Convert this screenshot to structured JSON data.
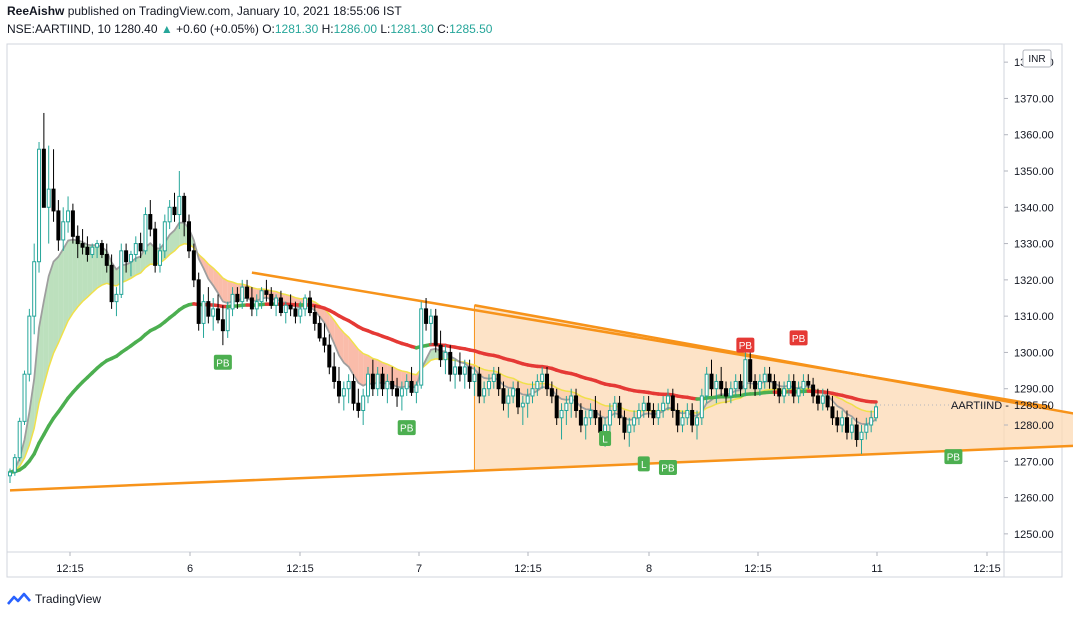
{
  "header": {
    "publisher": "ReeAishw",
    "published_text": "published on TradingView.com, January 10, 2021 18:55:06 IST",
    "symbol_tf": "NSE:AARTIIND, 10",
    "last": "1280.40",
    "change": "+0.60 (+0.05%)",
    "o_label": "O:",
    "o_value": "1281.30",
    "h_label": "H:",
    "h_value": "1286.00",
    "l_label": "L:",
    "l_value": "1281.30",
    "c_label": "C:",
    "c_value": "1285.50"
  },
  "footer": {
    "brand": "TradingView"
  },
  "colors": {
    "up": "#26a69a",
    "down": "#000000",
    "trend": "#f7931a",
    "ema_fast": "#9e9e9e",
    "ema_slow": "#4caf50",
    "ema_mid": "#f0e04a",
    "cloud_up": "#a5d6a7",
    "cloud_dn": "#f8a58e",
    "triangle_fill": "#fcd9b4",
    "red_ma": "#e53935",
    "pb_green": "#4caf50",
    "pb_red": "#e53935"
  },
  "chart_data": {
    "type": "candlestick",
    "symbol": "AARTIIND",
    "currency": "INR",
    "last_price_label": "AARTIIND",
    "last_price": 1285.5,
    "ylim": [
      1245,
      1385
    ],
    "y_ticks": [
      1250,
      1260,
      1270,
      1280,
      1290,
      1300,
      1310,
      1320,
      1330,
      1340,
      1350,
      1360,
      1370,
      1380
    ],
    "x_ticks": [
      "12:15",
      "6",
      "12:15",
      "7",
      "12:15",
      "8",
      "12:15",
      "11",
      "12:15"
    ],
    "grid": false,
    "session_labels": [
      "6",
      "7",
      "8",
      "11"
    ],
    "signals": [
      {
        "label": "PB",
        "bar": 44,
        "price": 1301,
        "side": "below",
        "color": "green"
      },
      {
        "label": "PB",
        "bar": 82,
        "price": 1283,
        "side": "below",
        "color": "green"
      },
      {
        "label": "L",
        "bar": 123,
        "price": 1280,
        "side": "below",
        "color": "green"
      },
      {
        "label": "L",
        "bar": 131,
        "price": 1273,
        "side": "below",
        "color": "green"
      },
      {
        "label": "PB",
        "bar": 136,
        "price": 1272,
        "side": "below",
        "color": "green"
      },
      {
        "label": "PB",
        "bar": 152,
        "price": 1298,
        "side": "above",
        "color": "red"
      },
      {
        "label": "PB",
        "bar": 163,
        "price": 1300,
        "side": "above",
        "color": "red"
      },
      {
        "label": "PB",
        "bar": 195,
        "price": 1275,
        "side": "below",
        "color": "green"
      }
    ],
    "trendlines": [
      {
        "from": [
          0,
          1262
        ],
        "to": [
          233,
          1275
        ]
      },
      {
        "from": [
          50,
          1322
        ],
        "to": [
          215,
          1285
        ]
      },
      {
        "from": [
          96,
          1313
        ],
        "to": [
          233,
          1280
        ]
      }
    ],
    "candles": [
      [
        1266,
        1268,
        1264,
        1267
      ],
      [
        1267,
        1272,
        1266,
        1271
      ],
      [
        1271,
        1282,
        1270,
        1281
      ],
      [
        1281,
        1295,
        1280,
        1294
      ],
      [
        1294,
        1312,
        1292,
        1310
      ],
      [
        1310,
        1330,
        1305,
        1325
      ],
      [
        1325,
        1358,
        1322,
        1356
      ],
      [
        1356,
        1366,
        1350,
        1340
      ],
      [
        1340,
        1357,
        1330,
        1345
      ],
      [
        1345,
        1356,
        1336,
        1339
      ],
      [
        1339,
        1342,
        1328,
        1331
      ],
      [
        1331,
        1340,
        1328,
        1336
      ],
      [
        1336,
        1343,
        1333,
        1339
      ],
      [
        1339,
        1341,
        1330,
        1332
      ],
      [
        1332,
        1335,
        1326,
        1330
      ],
      [
        1330,
        1334,
        1327,
        1329
      ],
      [
        1329,
        1332,
        1325,
        1327
      ],
      [
        1327,
        1330,
        1326,
        1329
      ],
      [
        1329,
        1331,
        1326,
        1330
      ],
      [
        1330,
        1331,
        1326,
        1327
      ],
      [
        1327,
        1330,
        1322,
        1324
      ],
      [
        1324,
        1327,
        1312,
        1314
      ],
      [
        1314,
        1318,
        1310,
        1316
      ],
      [
        1316,
        1330,
        1315,
        1328
      ],
      [
        1328,
        1330,
        1322,
        1325
      ],
      [
        1325,
        1328,
        1321,
        1327
      ],
      [
        1327,
        1332,
        1325,
        1330
      ],
      [
        1330,
        1333,
        1326,
        1328
      ],
      [
        1328,
        1340,
        1327,
        1338
      ],
      [
        1338,
        1342,
        1332,
        1334
      ],
      [
        1334,
        1336,
        1322,
        1324
      ],
      [
        1324,
        1330,
        1322,
        1328
      ],
      [
        1328,
        1338,
        1326,
        1336
      ],
      [
        1336,
        1342,
        1334,
        1340
      ],
      [
        1340,
        1344,
        1336,
        1338
      ],
      [
        1338,
        1350,
        1334,
        1343
      ],
      [
        1343,
        1344,
        1332,
        1336
      ],
      [
        1336,
        1338,
        1326,
        1328
      ],
      [
        1328,
        1330,
        1318,
        1320
      ],
      [
        1320,
        1322,
        1306,
        1308
      ],
      [
        1308,
        1316,
        1304,
        1314
      ],
      [
        1314,
        1318,
        1308,
        1310
      ],
      [
        1310,
        1315,
        1306,
        1312
      ],
      [
        1312,
        1316,
        1308,
        1309
      ],
      [
        1309,
        1313,
        1302,
        1306
      ],
      [
        1306,
        1314,
        1304,
        1312
      ],
      [
        1312,
        1318,
        1310,
        1316
      ],
      [
        1316,
        1318,
        1312,
        1314
      ],
      [
        1314,
        1320,
        1312,
        1318
      ],
      [
        1318,
        1320,
        1314,
        1315
      ],
      [
        1315,
        1318,
        1310,
        1312
      ],
      [
        1312,
        1316,
        1310,
        1314
      ],
      [
        1314,
        1318,
        1312,
        1317
      ],
      [
        1317,
        1320,
        1314,
        1316
      ],
      [
        1316,
        1318,
        1312,
        1313
      ],
      [
        1313,
        1316,
        1310,
        1315
      ],
      [
        1315,
        1317,
        1310,
        1311
      ],
      [
        1311,
        1314,
        1308,
        1313
      ],
      [
        1313,
        1316,
        1310,
        1312
      ],
      [
        1312,
        1314,
        1308,
        1310
      ],
      [
        1310,
        1314,
        1308,
        1312
      ],
      [
        1312,
        1316,
        1310,
        1315
      ],
      [
        1315,
        1317,
        1310,
        1311
      ],
      [
        1311,
        1313,
        1306,
        1308
      ],
      [
        1308,
        1310,
        1303,
        1304
      ],
      [
        1304,
        1308,
        1300,
        1302
      ],
      [
        1302,
        1305,
        1294,
        1296
      ],
      [
        1296,
        1300,
        1290,
        1292
      ],
      [
        1292,
        1296,
        1286,
        1288
      ],
      [
        1288,
        1292,
        1284,
        1290
      ],
      [
        1290,
        1294,
        1286,
        1292
      ],
      [
        1292,
        1294,
        1284,
        1286
      ],
      [
        1286,
        1290,
        1282,
        1284
      ],
      [
        1284,
        1290,
        1280,
        1288
      ],
      [
        1288,
        1296,
        1286,
        1294
      ],
      [
        1294,
        1298,
        1288,
        1290
      ],
      [
        1290,
        1296,
        1288,
        1294
      ],
      [
        1294,
        1296,
        1288,
        1290
      ],
      [
        1290,
        1294,
        1286,
        1292
      ],
      [
        1292,
        1296,
        1288,
        1290
      ],
      [
        1290,
        1293,
        1285,
        1288
      ],
      [
        1288,
        1292,
        1284,
        1290
      ],
      [
        1290,
        1294,
        1288,
        1292
      ],
      [
        1292,
        1296,
        1288,
        1289
      ],
      [
        1289,
        1292,
        1286,
        1291
      ],
      [
        1291,
        1314,
        1290,
        1312
      ],
      [
        1312,
        1315,
        1306,
        1308
      ],
      [
        1308,
        1312,
        1302,
        1310
      ],
      [
        1310,
        1312,
        1300,
        1302
      ],
      [
        1302,
        1306,
        1296,
        1298
      ],
      [
        1298,
        1302,
        1294,
        1300
      ],
      [
        1300,
        1302,
        1292,
        1294
      ],
      [
        1294,
        1298,
        1290,
        1296
      ],
      [
        1296,
        1300,
        1292,
        1294
      ],
      [
        1294,
        1298,
        1290,
        1296
      ],
      [
        1296,
        1298,
        1290,
        1292
      ],
      [
        1292,
        1296,
        1288,
        1294
      ],
      [
        1294,
        1296,
        1286,
        1288
      ],
      [
        1288,
        1292,
        1286,
        1290
      ],
      [
        1290,
        1294,
        1288,
        1292
      ],
      [
        1292,
        1296,
        1290,
        1294
      ],
      [
        1294,
        1296,
        1288,
        1290
      ],
      [
        1290,
        1292,
        1284,
        1286
      ],
      [
        1286,
        1290,
        1282,
        1288
      ],
      [
        1288,
        1292,
        1286,
        1290
      ],
      [
        1290,
        1292,
        1283,
        1285
      ],
      [
        1285,
        1288,
        1280,
        1286
      ],
      [
        1286,
        1290,
        1282,
        1288
      ],
      [
        1288,
        1292,
        1286,
        1290
      ],
      [
        1290,
        1294,
        1288,
        1292
      ],
      [
        1292,
        1296,
        1290,
        1294
      ],
      [
        1294,
        1296,
        1288,
        1290
      ],
      [
        1290,
        1292,
        1286,
        1288
      ],
      [
        1288,
        1290,
        1280,
        1282
      ],
      [
        1282,
        1286,
        1276,
        1284
      ],
      [
        1284,
        1288,
        1280,
        1286
      ],
      [
        1286,
        1290,
        1282,
        1288
      ],
      [
        1288,
        1290,
        1282,
        1284
      ],
      [
        1284,
        1286,
        1278,
        1280
      ],
      [
        1280,
        1284,
        1276,
        1282
      ],
      [
        1282,
        1286,
        1280,
        1284
      ],
      [
        1284,
        1288,
        1280,
        1282
      ],
      [
        1282,
        1284,
        1276,
        1278
      ],
      [
        1278,
        1282,
        1274,
        1280
      ],
      [
        1280,
        1286,
        1278,
        1284
      ],
      [
        1284,
        1288,
        1282,
        1286
      ],
      [
        1286,
        1288,
        1280,
        1282
      ],
      [
        1282,
        1284,
        1276,
        1278
      ],
      [
        1278,
        1282,
        1274,
        1280
      ],
      [
        1280,
        1284,
        1278,
        1282
      ],
      [
        1282,
        1286,
        1280,
        1284
      ],
      [
        1284,
        1288,
        1282,
        1286
      ],
      [
        1286,
        1288,
        1282,
        1284
      ],
      [
        1284,
        1286,
        1280,
        1282
      ],
      [
        1282,
        1286,
        1280,
        1284
      ],
      [
        1284,
        1288,
        1282,
        1286
      ],
      [
        1286,
        1290,
        1284,
        1288
      ],
      [
        1288,
        1290,
        1282,
        1284
      ],
      [
        1284,
        1286,
        1278,
        1280
      ],
      [
        1280,
        1284,
        1278,
        1282
      ],
      [
        1282,
        1286,
        1280,
        1284
      ],
      [
        1284,
        1286,
        1278,
        1280
      ],
      [
        1280,
        1284,
        1276,
        1282
      ],
      [
        1282,
        1290,
        1280,
        1288
      ],
      [
        1288,
        1296,
        1286,
        1294
      ],
      [
        1294,
        1298,
        1288,
        1290
      ],
      [
        1290,
        1294,
        1286,
        1292
      ],
      [
        1292,
        1296,
        1288,
        1290
      ],
      [
        1290,
        1292,
        1286,
        1288
      ],
      [
        1288,
        1292,
        1286,
        1290
      ],
      [
        1290,
        1294,
        1288,
        1292
      ],
      [
        1292,
        1294,
        1288,
        1290
      ],
      [
        1290,
        1300,
        1288,
        1298
      ],
      [
        1298,
        1300,
        1290,
        1292
      ],
      [
        1292,
        1294,
        1288,
        1290
      ],
      [
        1290,
        1294,
        1288,
        1292
      ],
      [
        1292,
        1296,
        1290,
        1294
      ],
      [
        1294,
        1296,
        1290,
        1292
      ],
      [
        1292,
        1294,
        1288,
        1290
      ],
      [
        1290,
        1292,
        1286,
        1288
      ],
      [
        1288,
        1292,
        1286,
        1290
      ],
      [
        1290,
        1294,
        1288,
        1292
      ],
      [
        1292,
        1294,
        1286,
        1288
      ],
      [
        1288,
        1292,
        1286,
        1290
      ],
      [
        1290,
        1294,
        1288,
        1292
      ],
      [
        1292,
        1294,
        1290,
        1291
      ],
      [
        1291,
        1293,
        1286,
        1288
      ],
      [
        1288,
        1290,
        1284,
        1286
      ],
      [
        1286,
        1290,
        1284,
        1288
      ],
      [
        1288,
        1290,
        1284,
        1285
      ],
      [
        1285,
        1288,
        1280,
        1282
      ],
      [
        1282,
        1284,
        1278,
        1280
      ],
      [
        1280,
        1284,
        1278,
        1282
      ],
      [
        1282,
        1284,
        1276,
        1278
      ],
      [
        1278,
        1282,
        1276,
        1280
      ],
      [
        1280,
        1282,
        1274,
        1276
      ],
      [
        1276,
        1280,
        1272,
        1278
      ],
      [
        1278,
        1282,
        1276,
        1280
      ],
      [
        1280,
        1284,
        1278,
        1282
      ],
      [
        1282,
        1286,
        1281,
        1285
      ]
    ]
  }
}
